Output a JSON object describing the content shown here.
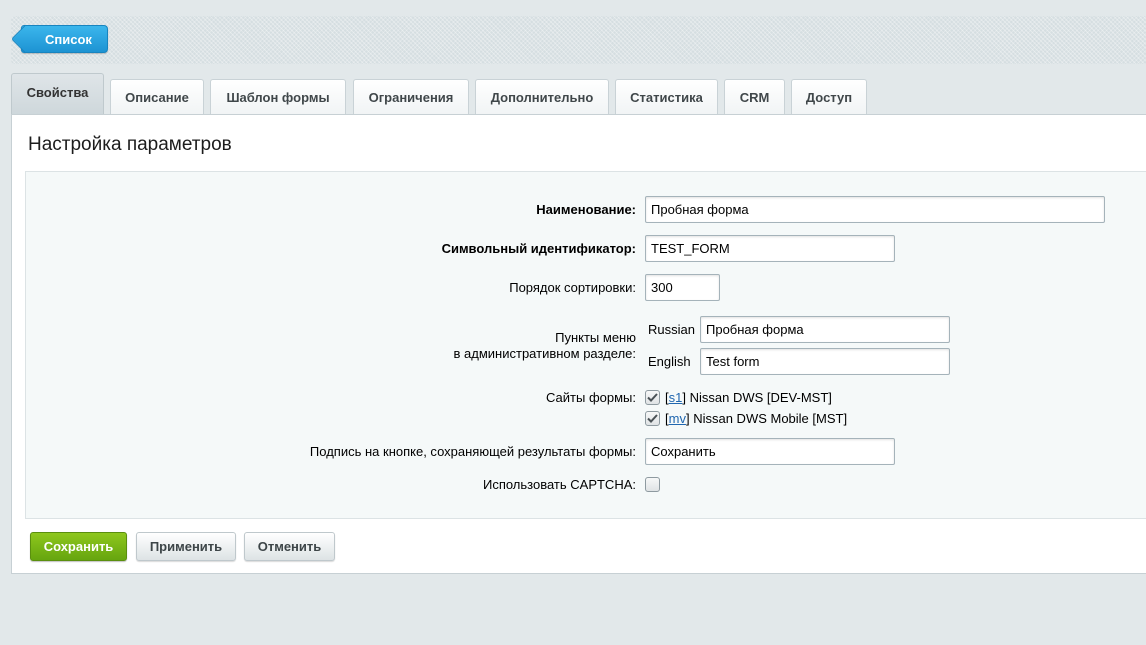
{
  "toolbar": {
    "back_label": "Список"
  },
  "tabs": [
    {
      "label": "Свойства",
      "active": true
    },
    {
      "label": "Описание"
    },
    {
      "label": "Шаблон формы"
    },
    {
      "label": "Ограничения"
    },
    {
      "label": "Дополнительно"
    },
    {
      "label": "Статистика"
    },
    {
      "label": "CRM"
    },
    {
      "label": "Доступ"
    }
  ],
  "panel": {
    "title": "Настройка параметров"
  },
  "form": {
    "name": {
      "label": "Наименование:",
      "value": "Пробная форма"
    },
    "sid": {
      "label": "Символьный идентификатор:",
      "value": "TEST_FORM"
    },
    "sort": {
      "label": "Порядок сортировки:",
      "value": "300"
    },
    "menu": {
      "label_line1": "Пункты меню",
      "label_line2": "в административном разделе:",
      "items": [
        {
          "lang": "Russian",
          "value": "Пробная форма"
        },
        {
          "lang": "English",
          "value": "Test form"
        }
      ]
    },
    "sites": {
      "label": "Сайты формы:",
      "items": [
        {
          "code": "s1",
          "name": "Nissan DWS [DEV-MST]",
          "checked": true
        },
        {
          "code": "mv",
          "name": "Nissan DWS Mobile [MST]",
          "checked": true
        }
      ]
    },
    "button_caption": {
      "label": "Подпись на кнопке, сохраняющей результаты формы:",
      "value": "Сохранить"
    },
    "captcha": {
      "label": "Использовать CAPTCHA:",
      "checked": false
    }
  },
  "footer": {
    "save_label": "Сохранить",
    "apply_label": "Применить",
    "cancel_label": "Отменить"
  },
  "colors": {
    "accent_blue": "#1d93d3",
    "save_green": "#66a50f",
    "link": "#2067b0"
  }
}
